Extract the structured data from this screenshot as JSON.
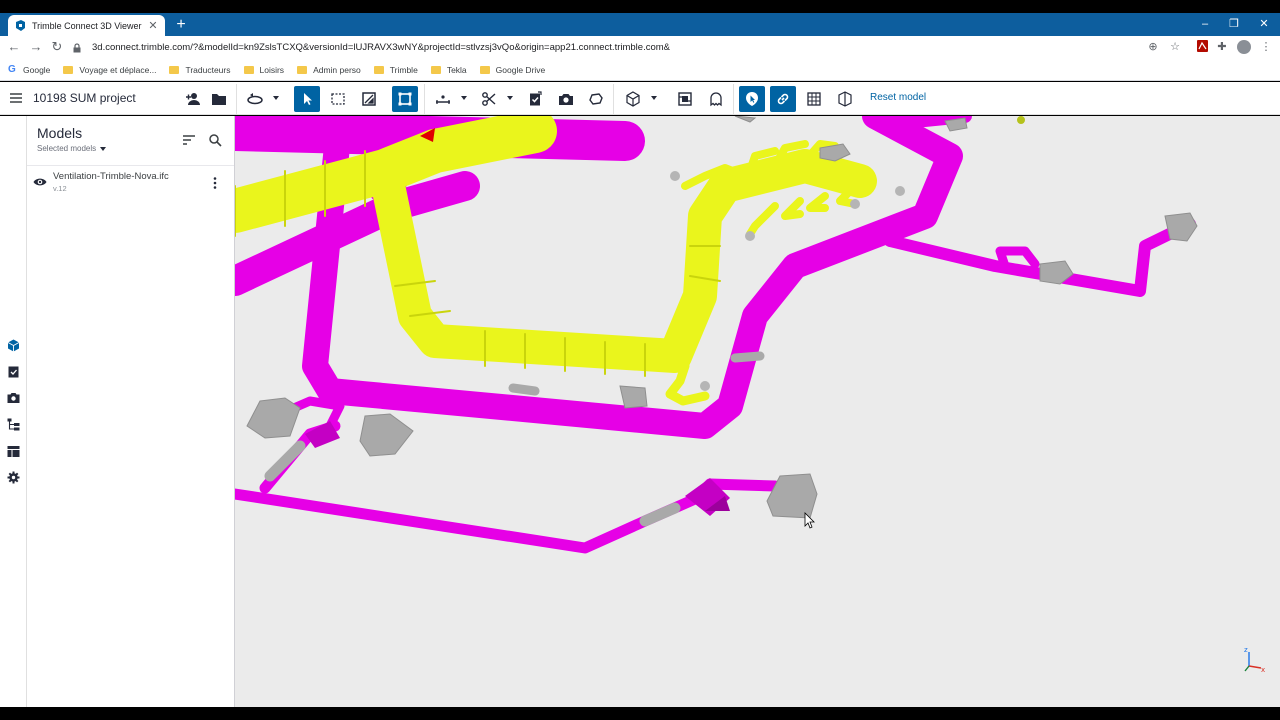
{
  "browser": {
    "tab_title": "Trimble Connect 3D Viewer",
    "url": "3d.connect.trimble.com/?&modelId=kn9ZslsTCXQ&versionId=lUJRAVX3wNY&projectId=stlvzsj3vQo&origin=app21.connect.trimble.com&",
    "bookmarks": [
      {
        "label": "Google",
        "type": "google"
      },
      {
        "label": "Voyage et déplace...",
        "type": "folder"
      },
      {
        "label": "Traducteurs",
        "type": "folder"
      },
      {
        "label": "Loisirs",
        "type": "folder"
      },
      {
        "label": "Admin perso",
        "type": "folder"
      },
      {
        "label": "Trimble",
        "type": "folder"
      },
      {
        "label": "Tekla",
        "type": "folder"
      },
      {
        "label": "Google Drive",
        "type": "folder"
      }
    ]
  },
  "app": {
    "project_name": "10198 SUM project",
    "reset_label": "Reset model",
    "accent_color": "#0063a3"
  },
  "models_panel": {
    "title": "Models",
    "subtitle": "Selected models",
    "models": [
      {
        "name": "Ventilation-Trimble-Nova.ifc",
        "version": "v.12"
      }
    ]
  },
  "scene": {
    "colors": {
      "supply_duct": "#e600e6",
      "exhaust_duct": "#eaf51c",
      "equipment": "#a9a9a9",
      "background": "#ebebeb"
    }
  }
}
